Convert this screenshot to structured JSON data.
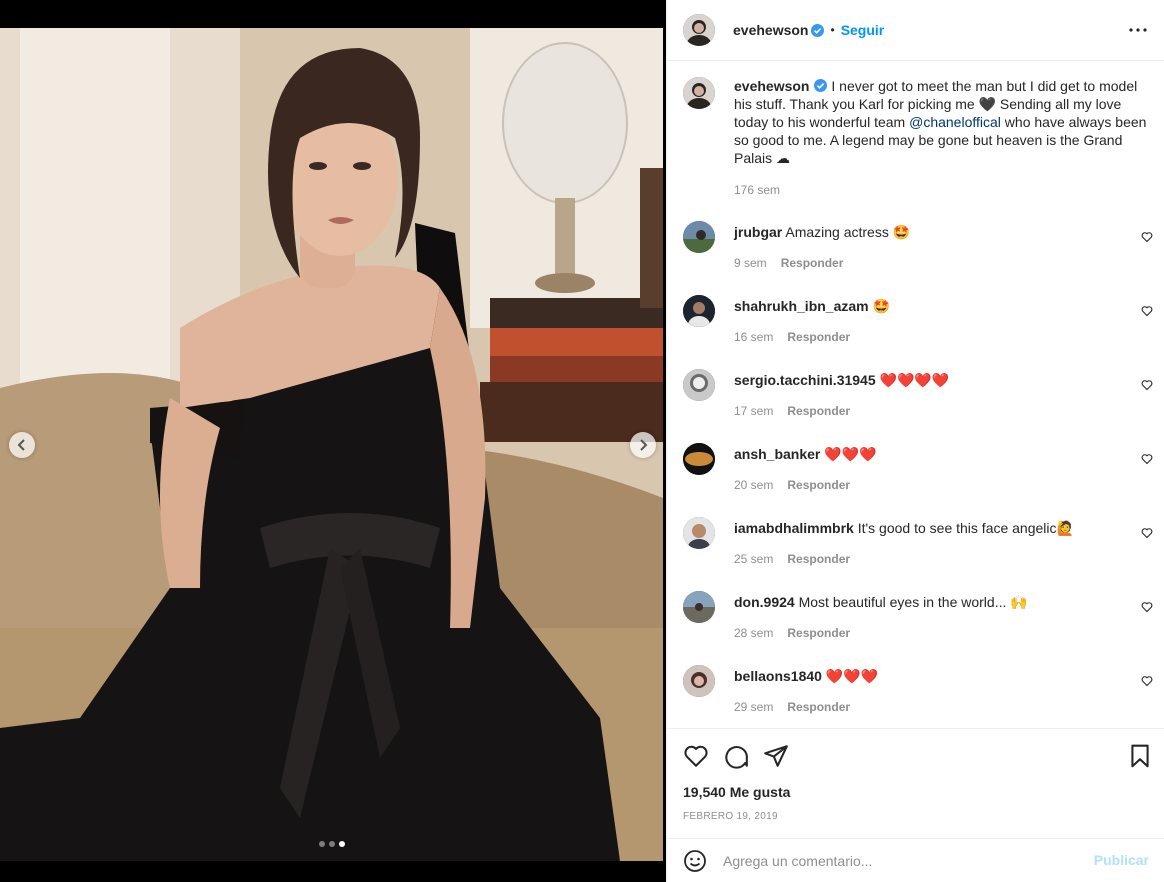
{
  "post": {
    "username": "evehewson",
    "separator": "•",
    "follow_label": "Seguir"
  },
  "caption": {
    "username": "evehewson",
    "text_1": "I never got to meet the man but I did get to model his stuff. Thank you Karl for picking me 🖤 Sending all my love today to his wonderful team ",
    "mention": "@chaneloffical",
    "text_2": " who have always been so good to me. A legend may be gone but heaven is the Grand Palais ☁",
    "time": "176 sem"
  },
  "reply_label": "Responder",
  "comments": [
    {
      "username": "jrubgar",
      "text": "Amazing actress 🤩",
      "time": "9 sem"
    },
    {
      "username": "shahrukh_ibn_azam",
      "text": "🤩",
      "time": "16 sem"
    },
    {
      "username": "sergio.tacchini.31945",
      "text": "❤️❤️❤️❤️",
      "time": "17 sem"
    },
    {
      "username": "ansh_banker",
      "text": "❤️❤️❤️",
      "time": "20 sem"
    },
    {
      "username": "iamabdhalimmbrk",
      "text": "It's good to see this face angelic🙋",
      "time": "25 sem"
    },
    {
      "username": "don.9924",
      "text": "Most beautiful eyes in the world... 🙌",
      "time": "28 sem"
    },
    {
      "username": "bellaons1840",
      "text": "❤️❤️❤️",
      "time": "29 sem"
    }
  ],
  "likes": "19,540 Me gusta",
  "date": "FEBRERO 19, 2019",
  "composer": {
    "placeholder": "Agrega un comentario...",
    "publish_label": "Publicar"
  },
  "carousel": {
    "slides": 3,
    "active": 3
  },
  "colors": {
    "accent": "#0095f6",
    "mention": "#00376b",
    "muted": "#8e8e8e",
    "publish_disabled": "#b2dffc"
  }
}
